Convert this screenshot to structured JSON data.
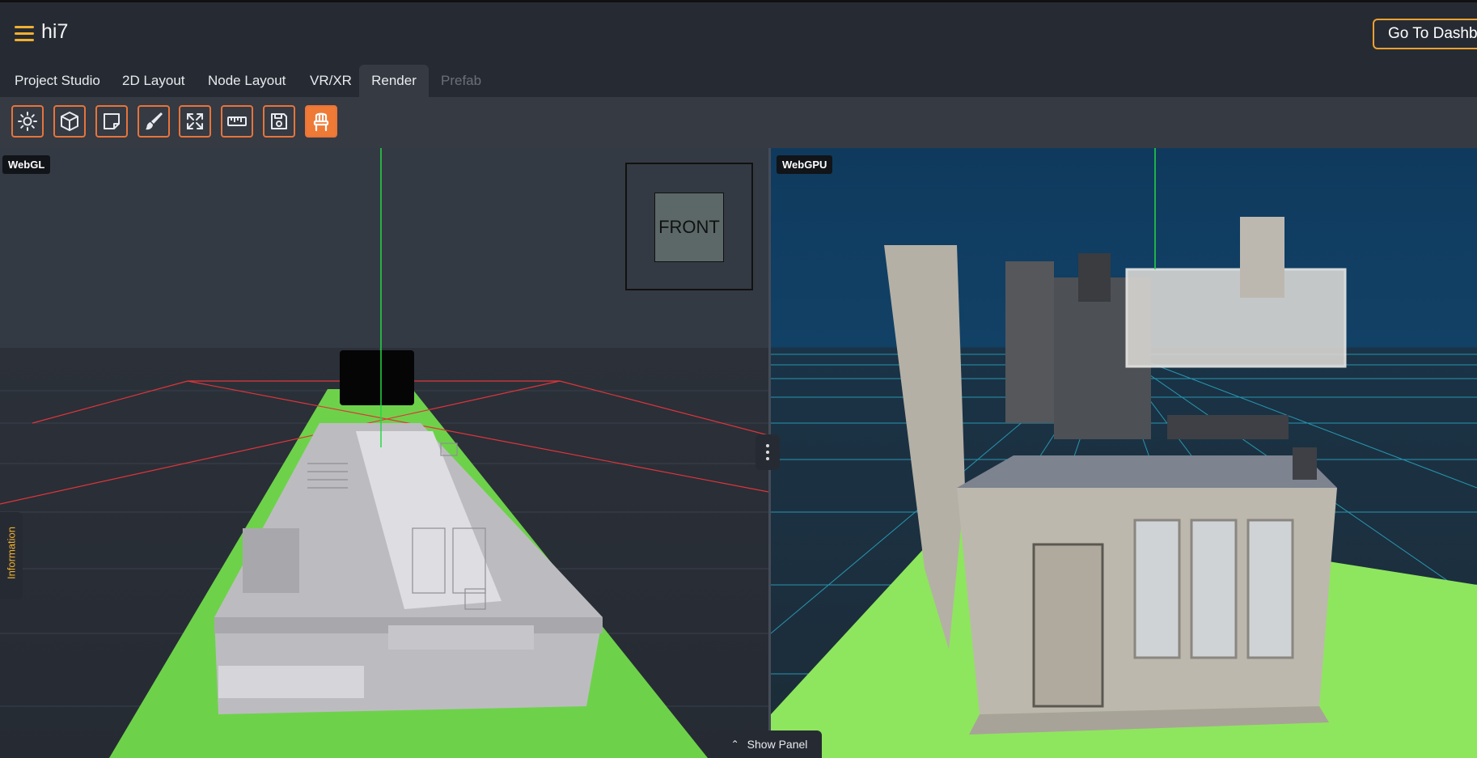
{
  "app": {
    "title": "hi7"
  },
  "header": {
    "dashboard_button": "Go To Dashboard"
  },
  "tabs": [
    {
      "label": "Project Studio"
    },
    {
      "label": "2D Layout"
    },
    {
      "label": "Node Layout"
    },
    {
      "label": "VR/XR"
    },
    {
      "label": "Render",
      "active": true
    },
    {
      "label": "Prefab",
      "disabled": true
    }
  ],
  "toolbar": {
    "tools": [
      {
        "icon": "sun-icon"
      },
      {
        "icon": "cube-icon"
      },
      {
        "icon": "sticky-note-icon"
      },
      {
        "icon": "paint-brush-icon"
      },
      {
        "icon": "expand-icon"
      },
      {
        "icon": "ruler-icon"
      },
      {
        "icon": "save-icon"
      },
      {
        "icon": "chair-icon",
        "active": true
      }
    ]
  },
  "viewports": {
    "left": {
      "badge": "WebGL",
      "gizmo_label": "FRONT"
    },
    "right": {
      "badge": "WebGPU"
    }
  },
  "side_panel": {
    "label": "Information"
  },
  "bottom_panel": {
    "label": "Show Panel"
  },
  "colors": {
    "accent": "#f0a030",
    "tool_border": "#e8743a",
    "ground_green": "#6dd24a",
    "sky_blue": "#124166"
  }
}
